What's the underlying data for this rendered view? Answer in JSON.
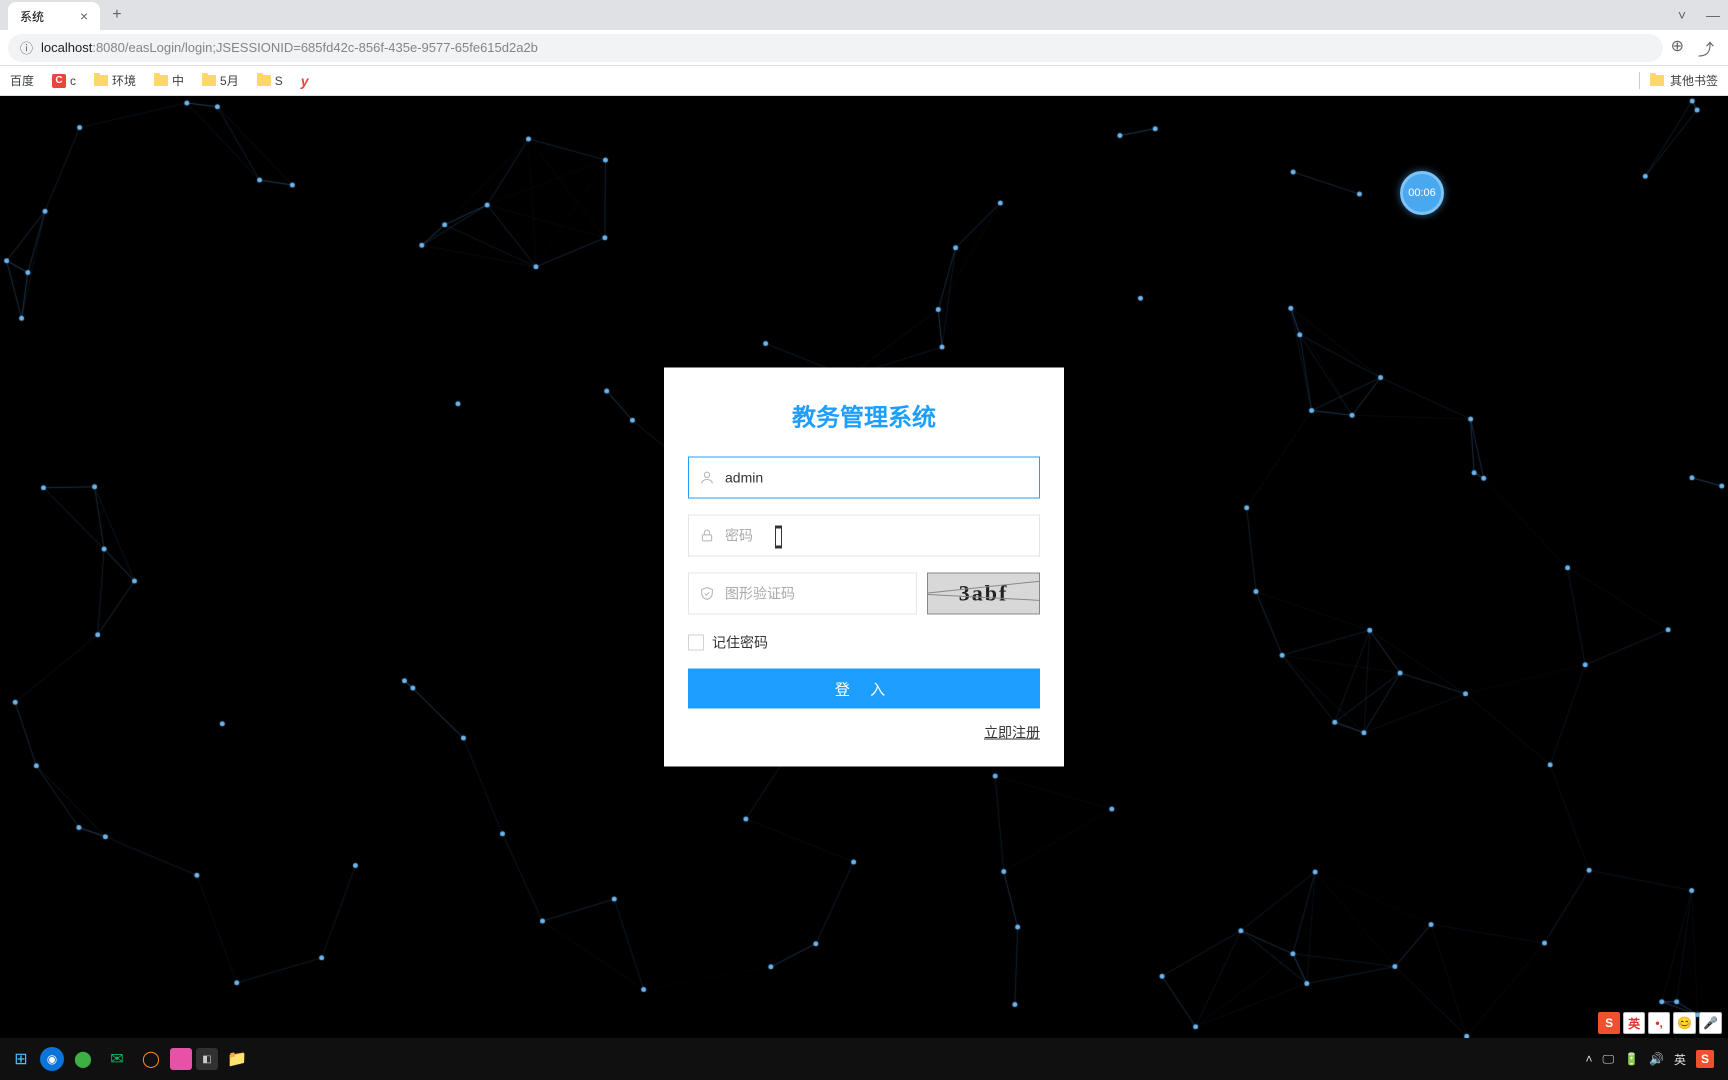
{
  "browser": {
    "tab_title": "系统",
    "url_host": "localhost",
    "url_port_path": ":8080/easLogin/login;JSESSIONID=685fd42c-856f-435e-9577-65fe615d2a2b",
    "bookmarks": {
      "b1": "百度",
      "b2": "c",
      "b3": "环境",
      "b4": "中",
      "b5": "5月",
      "b6": "S",
      "b7": "y",
      "other": "其他书签"
    }
  },
  "timer": "00:06",
  "login": {
    "title": "教务管理系统",
    "username_value": "admin",
    "password_placeholder": "密码",
    "captcha_placeholder": "图形验证码",
    "captcha_text": "3abf",
    "remember": "记住密码",
    "submit": "登 入",
    "register": "立即注册"
  },
  "ime": {
    "i1": "S",
    "i2": "英",
    "i3": "•,",
    "i4": "😊",
    "i5": "🎤"
  },
  "tray": {
    "t1": "英",
    "t2": "S"
  }
}
